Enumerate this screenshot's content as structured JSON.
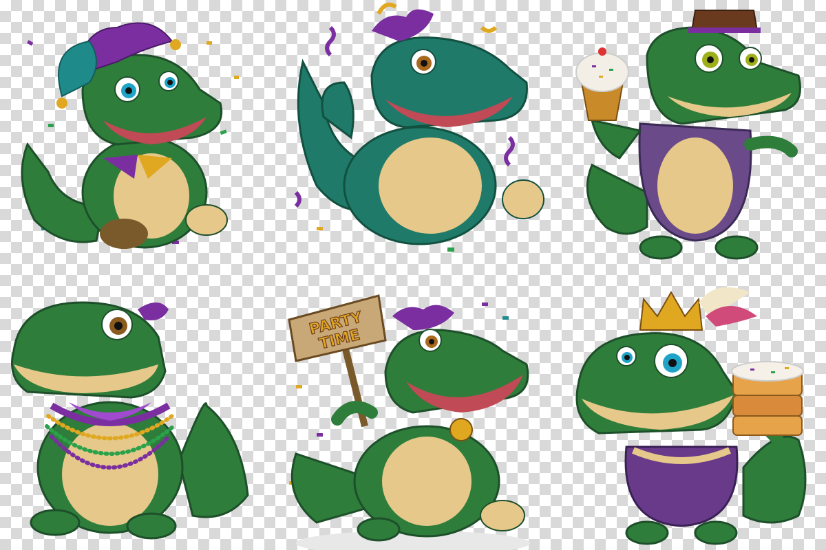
{
  "stickers": [
    {
      "subject": "alligator-jester"
    },
    {
      "subject": "alligator-confetti"
    },
    {
      "subject": "alligator-cupcake"
    },
    {
      "subject": "alligator-beads"
    },
    {
      "subject": "alligator-party-sign",
      "sign_text": "PARTY TIME"
    },
    {
      "subject": "alligator-king-cake"
    }
  ],
  "colors": {
    "gator_green": "#2f7d3a",
    "gator_dark": "#1d4f2a",
    "belly": "#e6c98a",
    "mardi_purple": "#7a2ea0",
    "mardi_gold": "#e0a821",
    "mardi_green": "#2aa14a",
    "teal": "#1f8a8a"
  }
}
